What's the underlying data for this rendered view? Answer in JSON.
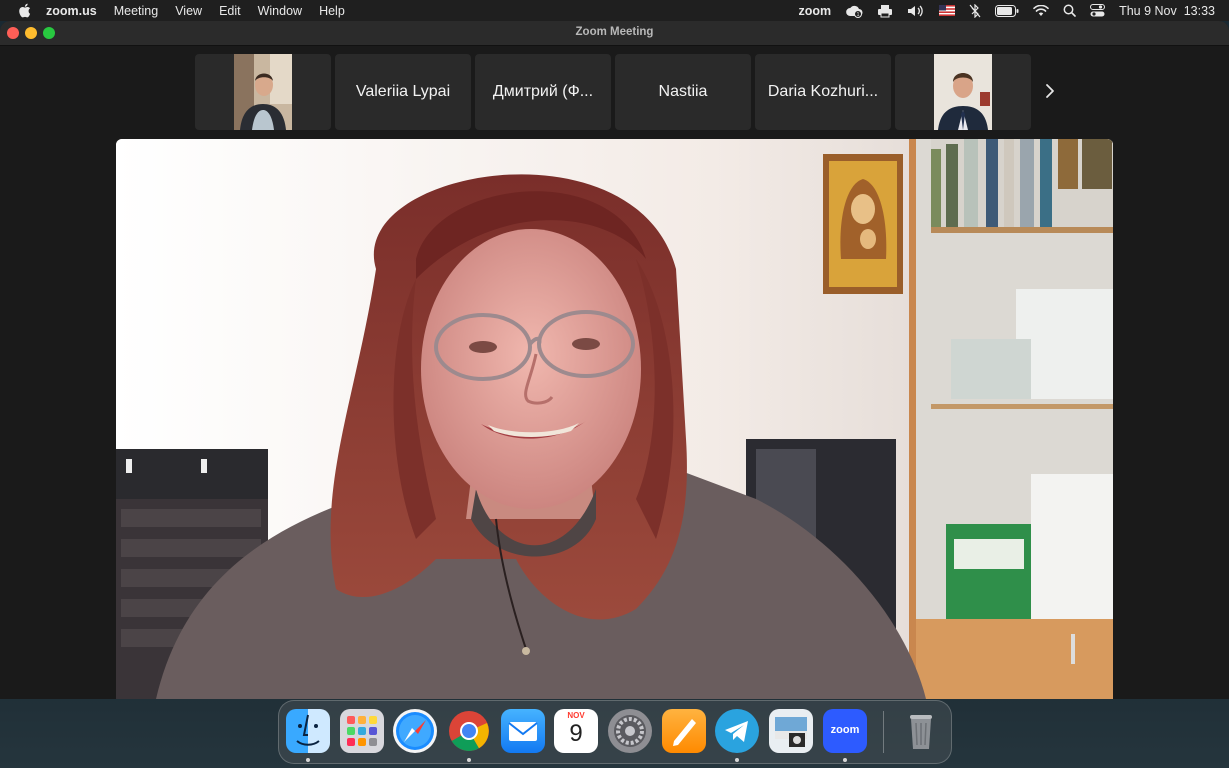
{
  "menubar": {
    "app_name": "zoom.us",
    "menus": [
      "Meeting",
      "View",
      "Edit",
      "Window",
      "Help"
    ],
    "zoom_status_label": "zoom",
    "datetime": "Thu 9 Nov  13:33"
  },
  "window": {
    "title": "Zoom Meeting"
  },
  "participants": [
    {
      "name": "",
      "has_video": true
    },
    {
      "name": "Valeriia Lypai",
      "has_video": false
    },
    {
      "name": "Дмитрий (Ф...",
      "has_video": false
    },
    {
      "name": "Nastiia",
      "has_video": false
    },
    {
      "name": "Daria Kozhuri...",
      "has_video": false
    },
    {
      "name": "",
      "has_video": true
    }
  ],
  "dock": {
    "calendar_month": "NOV",
    "calendar_day": "9",
    "zoom_label": "zoom",
    "apps": [
      "finder",
      "launchpad",
      "safari",
      "chrome",
      "mail",
      "calendar",
      "system-settings",
      "pages",
      "telegram",
      "preview",
      "zoom",
      "trash"
    ]
  },
  "colors": {
    "menubar_bg": "#1f1f1f",
    "window_bg": "#1a1a1a",
    "tile_bg": "#2a2a2a",
    "close": "#ff5f57",
    "minimize": "#febc2e",
    "maximize": "#28c840",
    "zoom_blue": "#2d5bff"
  }
}
